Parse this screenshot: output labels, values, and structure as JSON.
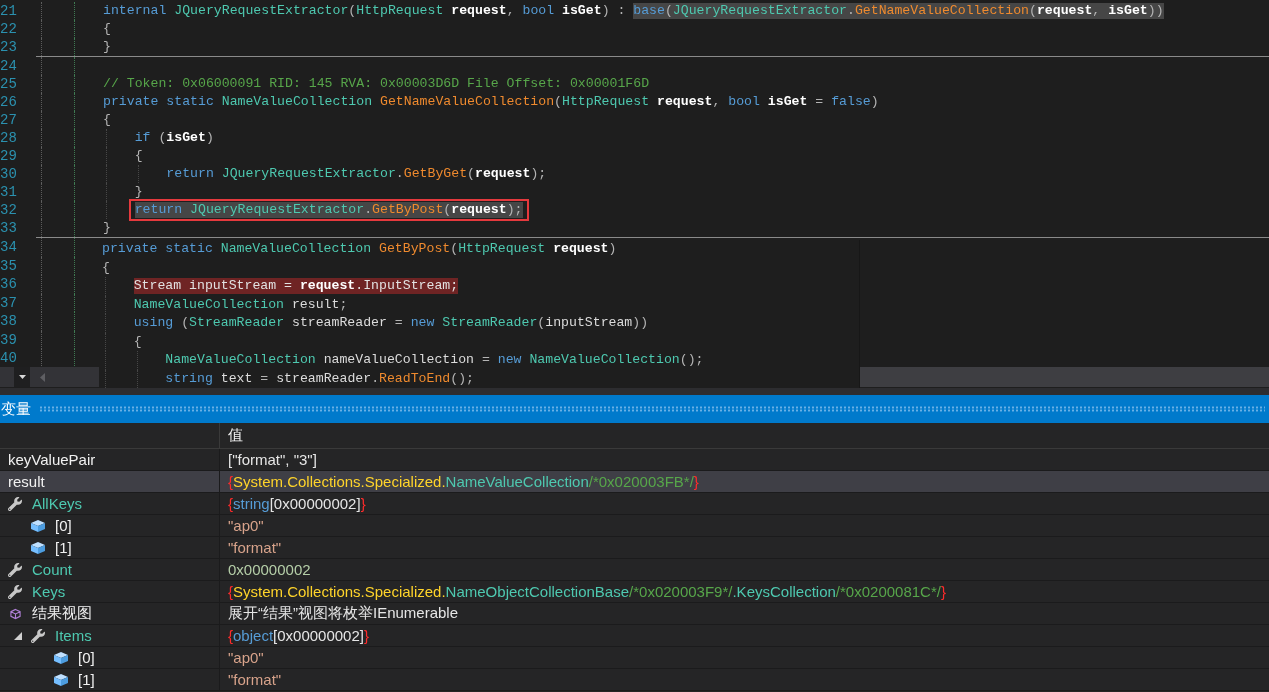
{
  "editor": {
    "lines": [
      {
        "number": "21",
        "tokens": [
          {
            "text": "internal ",
            "kind": "keyword"
          },
          {
            "text": "JQueryRequestExtractor",
            "kind": "type"
          },
          {
            "text": "(",
            "kind": "punct"
          },
          {
            "text": "HttpRequest ",
            "kind": "type"
          },
          {
            "text": "request",
            "kind": "param"
          },
          {
            "text": ", ",
            "kind": "punct"
          },
          {
            "text": "bool ",
            "kind": "keyword"
          },
          {
            "text": "isGet",
            "kind": "param"
          },
          {
            "text": ") : ",
            "kind": "punct"
          }
        ],
        "highlight": {
          "kind": "selection",
          "tokens": [
            {
              "text": "base",
              "kind": "keyword"
            },
            {
              "text": "(",
              "kind": "punct"
            },
            {
              "text": "JQueryRequestExtractor",
              "kind": "type"
            },
            {
              "text": ".",
              "kind": "punct"
            },
            {
              "text": "GetNameValueCollection",
              "kind": "method"
            },
            {
              "text": "(",
              "kind": "punct"
            },
            {
              "text": "request",
              "kind": "param"
            },
            {
              "text": ", ",
              "kind": "punct"
            },
            {
              "text": "isGet",
              "kind": "param"
            },
            {
              "text": "))",
              "kind": "punct"
            }
          ]
        }
      },
      {
        "number": "22",
        "tokens": [
          {
            "text": "{",
            "kind": "punct"
          }
        ]
      },
      {
        "number": "23",
        "tokens": [
          {
            "text": "}",
            "kind": "punct"
          }
        ]
      },
      {
        "number": "24",
        "separator": true
      },
      {
        "number": "25",
        "tokens": [
          {
            "text": "// Token: 0x06000091 RID: 145 RVA: 0x00003D6D File Offset: 0x00001F6D",
            "kind": "comment"
          }
        ]
      },
      {
        "number": "26",
        "tokens": [
          {
            "text": "private ",
            "kind": "keyword"
          },
          {
            "text": "static ",
            "kind": "keyword"
          },
          {
            "text": "NameValueCollection ",
            "kind": "type"
          },
          {
            "text": "GetNameValueCollection",
            "kind": "method"
          },
          {
            "text": "(",
            "kind": "punct"
          },
          {
            "text": "HttpRequest ",
            "kind": "type"
          },
          {
            "text": "request",
            "kind": "param"
          },
          {
            "text": ", ",
            "kind": "punct"
          },
          {
            "text": "bool ",
            "kind": "keyword"
          },
          {
            "text": "isGet",
            "kind": "param"
          },
          {
            "text": " = ",
            "kind": "punct"
          },
          {
            "text": "false",
            "kind": "keyword"
          },
          {
            "text": ")",
            "kind": "punct"
          }
        ]
      },
      {
        "number": "27",
        "tokens": [
          {
            "text": "{",
            "kind": "punct"
          }
        ],
        "children": [
          {
            "number": "28",
            "tokens": [
              {
                "text": "if ",
                "kind": "keyword"
              },
              {
                "text": "(",
                "kind": "punct"
              },
              {
                "text": "isGet",
                "kind": "param"
              },
              {
                "text": ")",
                "kind": "punct"
              }
            ]
          },
          {
            "number": "29",
            "tokens": [
              {
                "text": "{",
                "kind": "punct"
              }
            ],
            "children": [
              {
                "number": "30",
                "tokens": [
                  {
                    "text": "return ",
                    "kind": "keyword"
                  },
                  {
                    "text": "JQueryRequestExtractor",
                    "kind": "type"
                  },
                  {
                    "text": ".",
                    "kind": "punct"
                  },
                  {
                    "text": "GetByGet",
                    "kind": "method"
                  },
                  {
                    "text": "(",
                    "kind": "punct"
                  },
                  {
                    "text": "request",
                    "kind": "param"
                  },
                  {
                    "text": ");",
                    "kind": "punct"
                  }
                ]
              }
            ]
          },
          {
            "number": "31",
            "tokens": [
              {
                "text": "}",
                "kind": "punct"
              }
            ]
          },
          {
            "number": "32",
            "highlight": {
              "kind": "boxed",
              "tokens": [
                {
                  "text": "return ",
                  "kind": "keyword"
                },
                {
                  "text": "JQueryRequestExtractor",
                  "kind": "type"
                },
                {
                  "text": ".",
                  "kind": "punct"
                },
                {
                  "text": "GetByPost",
                  "kind": "method"
                },
                {
                  "text": "(",
                  "kind": "punct"
                },
                {
                  "text": "request",
                  "kind": "param"
                },
                {
                  "text": ");",
                  "kind": "punct"
                }
              ]
            }
          }
        ]
      },
      {
        "number": "33",
        "tokens": [
          {
            "text": "}",
            "kind": "punct"
          }
        ]
      }
    ]
  },
  "peek": {
    "lines": [
      {
        "number": "34",
        "separator": true,
        "tokens": [
          {
            "text": "private ",
            "kind": "keyword"
          },
          {
            "text": "static ",
            "kind": "keyword"
          },
          {
            "text": "NameValueCollection ",
            "kind": "type"
          },
          {
            "text": "GetByPost",
            "kind": "method"
          },
          {
            "text": "(",
            "kind": "punct"
          },
          {
            "text": "HttpRequest ",
            "kind": "type"
          },
          {
            "text": "request",
            "kind": "param"
          },
          {
            "text": ")",
            "kind": "punct"
          }
        ]
      },
      {
        "number": "35",
        "tokens": [
          {
            "text": "{",
            "kind": "punct"
          }
        ],
        "children": [
          {
            "number": "36",
            "highlight": {
              "kind": "current",
              "tokens": [
                {
                  "text": "Stream inputStream = ",
                  "kind": "plain"
                },
                {
                  "text": "request",
                  "kind": "param"
                },
                {
                  "text": ".InputStream;",
                  "kind": "plain"
                }
              ]
            }
          },
          {
            "number": "37",
            "tokens": [
              {
                "text": "NameValueCollection ",
                "kind": "type"
              },
              {
                "text": "result",
                "kind": "local"
              },
              {
                "text": ";",
                "kind": "punct"
              }
            ]
          },
          {
            "number": "38",
            "tokens": [
              {
                "text": "using ",
                "kind": "keyword"
              },
              {
                "text": "(",
                "kind": "punct"
              },
              {
                "text": "StreamReader ",
                "kind": "type"
              },
              {
                "text": "streamReader",
                "kind": "local"
              },
              {
                "text": " = ",
                "kind": "punct"
              },
              {
                "text": "new ",
                "kind": "keyword"
              },
              {
                "text": "StreamReader",
                "kind": "type"
              },
              {
                "text": "(",
                "kind": "punct"
              },
              {
                "text": "inputStream",
                "kind": "local"
              },
              {
                "text": "))",
                "kind": "punct"
              }
            ]
          },
          {
            "number": "39",
            "tokens": [
              {
                "text": "{",
                "kind": "punct"
              }
            ],
            "children": [
              {
                "number": "40",
                "tokens": [
                  {
                    "text": "NameValueCollection ",
                    "kind": "type"
                  },
                  {
                    "text": "nameValueCollection",
                    "kind": "local"
                  },
                  {
                    "text": " = ",
                    "kind": "punct"
                  },
                  {
                    "text": "new ",
                    "kind": "keyword"
                  },
                  {
                    "text": "NameValueCollection",
                    "kind": "type"
                  },
                  {
                    "text": "();",
                    "kind": "punct"
                  }
                ]
              },
              {
                "tokens": [
                  {
                    "text": "string ",
                    "kind": "keyword"
                  },
                  {
                    "text": "text",
                    "kind": "local"
                  },
                  {
                    "text": " = ",
                    "kind": "punct"
                  },
                  {
                    "text": "streamReader",
                    "kind": "local"
                  },
                  {
                    "text": ".",
                    "kind": "punct"
                  },
                  {
                    "text": "ReadToEnd",
                    "kind": "method"
                  },
                  {
                    "text": "();",
                    "kind": "punct"
                  }
                ]
              }
            ]
          }
        ]
      }
    ]
  },
  "locals": {
    "title": "变量",
    "value_column": "值",
    "rows": [
      {
        "kind": "variable",
        "name": "keyValuePair",
        "selected": false,
        "value": [
          {
            "text": "[\"format\", \"3\"]",
            "kind": "text"
          }
        ]
      },
      {
        "kind": "variable",
        "name": "result",
        "selected": true,
        "value": [
          {
            "text": "{",
            "kind": "brace"
          },
          {
            "text": "System.Collections.Specialized.",
            "kind": "namespace"
          },
          {
            "text": "NameValueCollection",
            "kind": "type"
          },
          {
            "text": "/*0x020003FB*/",
            "kind": "comment"
          },
          {
            "text": "}",
            "kind": "brace"
          }
        ],
        "children": [
          {
            "kind": "property",
            "name": "AllKeys",
            "selected": false,
            "value": [
              {
                "text": "{",
                "kind": "brace"
              },
              {
                "text": "string",
                "kind": "keyword"
              },
              {
                "text": "[0x00000002]",
                "kind": "text"
              },
              {
                "text": "}",
                "kind": "brace"
              }
            ],
            "children": [
              {
                "kind": "element",
                "name": "[0]",
                "selected": false,
                "value": [
                  {
                    "text": "\"ap0\"",
                    "kind": "string"
                  }
                ]
              },
              {
                "kind": "element",
                "name": "[1]",
                "selected": false,
                "value": [
                  {
                    "text": "\"format\"",
                    "kind": "string"
                  }
                ]
              }
            ]
          },
          {
            "kind": "property",
            "name": "Count",
            "selected": false,
            "value": [
              {
                "text": "0x00000002",
                "kind": "number"
              }
            ]
          },
          {
            "kind": "property",
            "name": "Keys",
            "selected": false,
            "value": [
              {
                "text": "{",
                "kind": "brace"
              },
              {
                "text": "System.Collections.Specialized.",
                "kind": "namespace"
              },
              {
                "text": "NameObjectCollectionBase",
                "kind": "type"
              },
              {
                "text": "/*0x020003F9*/",
                "kind": "comment"
              },
              {
                "text": ".KeysCollection",
                "kind": "type"
              },
              {
                "text": "/*0x0200081C*/",
                "kind": "comment"
              },
              {
                "text": "}",
                "kind": "brace"
              }
            ]
          },
          {
            "kind": "results_view",
            "name": "结果视图",
            "selected": false,
            "value": [
              {
                "text": "展开“结果”视图将枚举IEnumerable",
                "kind": "text"
              }
            ],
            "children": [
              {
                "kind": "property",
                "name": "Items",
                "expanded": true,
                "selected": false,
                "value": [
                  {
                    "text": "{",
                    "kind": "brace"
                  },
                  {
                    "text": "object",
                    "kind": "keyword"
                  },
                  {
                    "text": "[0x00000002]",
                    "kind": "text"
                  },
                  {
                    "text": "}",
                    "kind": "brace"
                  }
                ],
                "children": [
                  {
                    "kind": "element",
                    "name": "[0]",
                    "selected": false,
                    "value": [
                      {
                        "text": "\"ap0\"",
                        "kind": "string"
                      }
                    ]
                  },
                  {
                    "kind": "element",
                    "name": "[1]",
                    "selected": false,
                    "value": [
                      {
                        "text": "\"format\"",
                        "kind": "string"
                      }
                    ]
                  }
                ]
              }
            ]
          }
        ]
      }
    ]
  }
}
